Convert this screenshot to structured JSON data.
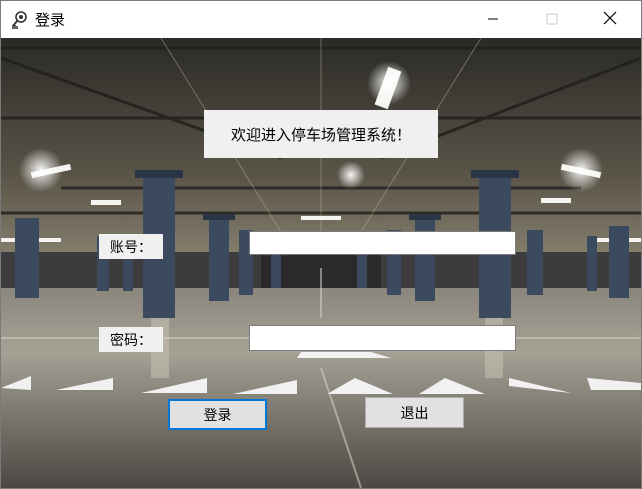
{
  "window": {
    "title": "登录",
    "icon": "key-lock-icon",
    "controls": {
      "minimize": "minimize-icon",
      "maximize": "maximize-icon",
      "close": "close-icon"
    }
  },
  "form": {
    "welcome_text": "欢迎进入停车场管理系统！",
    "account_label": "账号：",
    "account_value": "",
    "password_label": "密码：",
    "password_value": "",
    "login_button": "登录",
    "exit_button": "退出"
  },
  "colors": {
    "focus_border": "#0078d7",
    "label_bg": "#f0f0f0",
    "button_bg": "#e1e1e1"
  }
}
